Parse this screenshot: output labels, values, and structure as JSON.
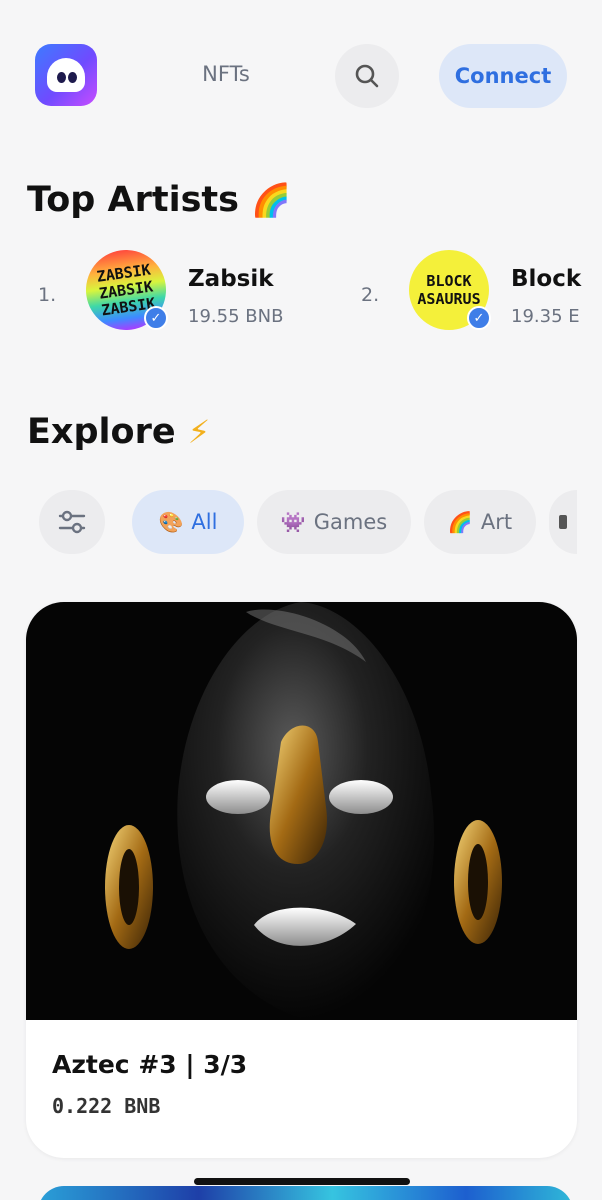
{
  "header": {
    "nav_label": "NFTs",
    "connect_label": "Connect",
    "icons": {
      "logo": "ghost-logo-icon",
      "search": "search-icon"
    }
  },
  "top_artists": {
    "title": "Top Artists",
    "emoji": "🌈",
    "items": [
      {
        "rank": "1.",
        "name": "Zabsik",
        "price": "19.55 BNB",
        "avatar_text": [
          "ZABSIK",
          "ZABSIK",
          "ZABSIK"
        ]
      },
      {
        "rank": "2.",
        "name": "Block",
        "price": "19.35 E",
        "avatar_text": [
          "BLOCK",
          "ASAURUS"
        ]
      }
    ]
  },
  "explore": {
    "title": "Explore",
    "emoji": "⚡",
    "chips": [
      {
        "emoji": "🎨",
        "label": "All",
        "active": true
      },
      {
        "emoji": "👾",
        "label": "Games",
        "active": false
      },
      {
        "emoji": "🌈",
        "label": "Art",
        "active": false
      }
    ]
  },
  "card": {
    "title": "Aztec #3 | 3/3",
    "price": "0.222 BNB"
  },
  "colors": {
    "accent": "#2f6fe0",
    "accent_bg": "#dde7f8",
    "chip_bg": "#ececee",
    "muted_text": "#6b7280",
    "page_bg": "#f6f6f7"
  }
}
